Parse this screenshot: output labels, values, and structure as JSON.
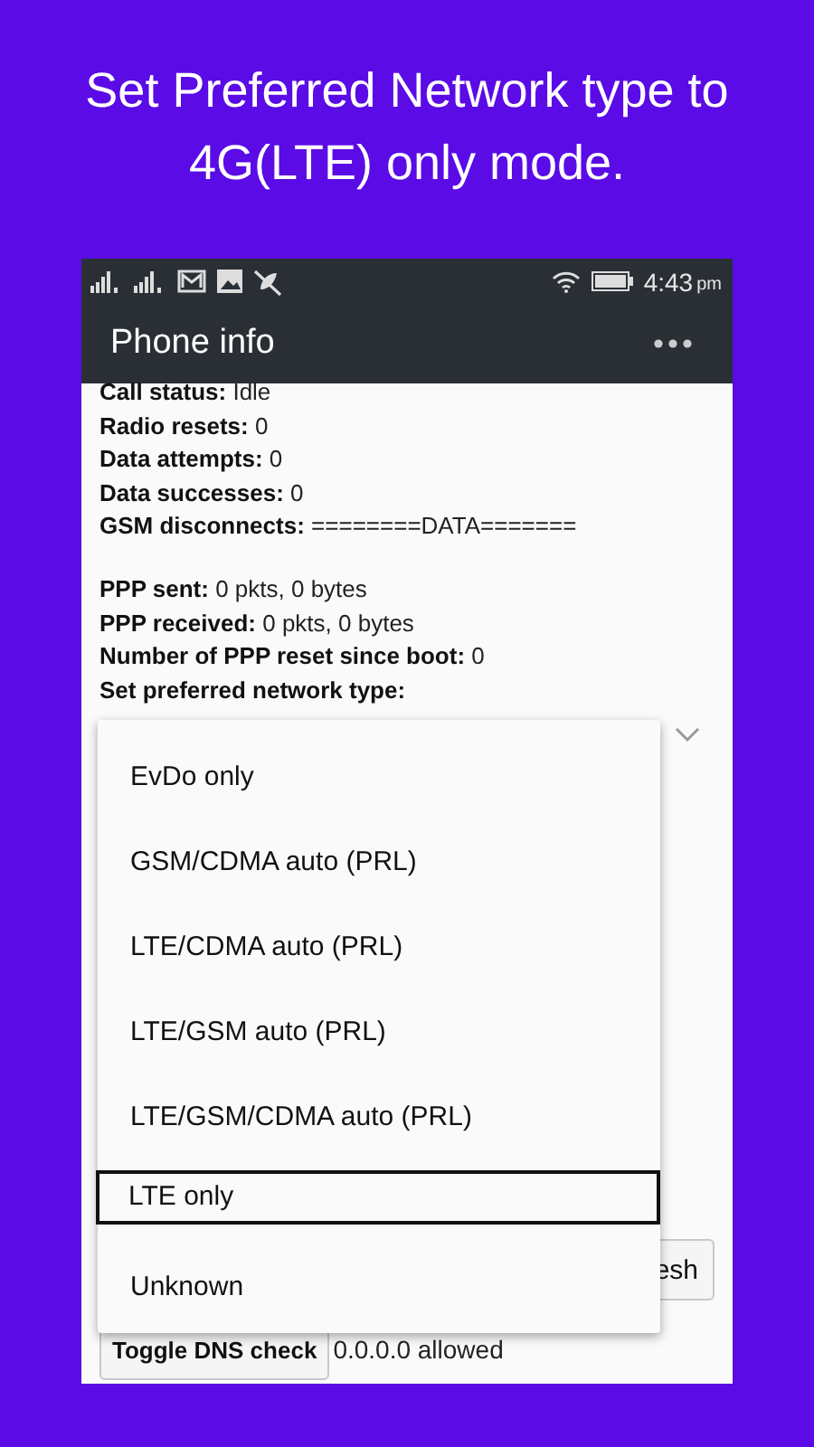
{
  "caption": "Set Preferred Network type to 4G(LTE) only mode.",
  "status_bar": {
    "time": "4:43",
    "period": "pm"
  },
  "app_bar": {
    "title": "Phone info"
  },
  "info_groups": [
    [
      {
        "label": "Call status:",
        "value": "Idle"
      },
      {
        "label": "Radio resets:",
        "value": "0"
      },
      {
        "label": "Data attempts:",
        "value": "0"
      },
      {
        "label": "Data successes:",
        "value": "0"
      },
      {
        "label": "GSM disconnects:",
        "value": "========DATA======="
      }
    ],
    [
      {
        "label": "PPP sent:",
        "value": "0 pkts, 0 bytes"
      },
      {
        "label": "PPP received:",
        "value": "0 pkts, 0 bytes"
      },
      {
        "label": "Number of PPP reset since boot:",
        "value": "0"
      }
    ]
  ],
  "network_type": {
    "label": "Set preferred network type:",
    "options": [
      {
        "label": "EvDo only",
        "selected": false
      },
      {
        "label": "GSM/CDMA auto (PRL)",
        "selected": false
      },
      {
        "label": "LTE/CDMA auto (PRL)",
        "selected": false
      },
      {
        "label": "LTE/GSM auto (PRL)",
        "selected": false
      },
      {
        "label": "LTE/GSM/CDMA auto (PRL)",
        "selected": false
      },
      {
        "label": "LTE only",
        "selected": true
      },
      {
        "label": "Unknown",
        "selected": false
      }
    ]
  },
  "refresh_button": {
    "label": "esh"
  },
  "dns": {
    "button": "Toggle DNS check",
    "status": "0.0.0.0 allowed"
  }
}
